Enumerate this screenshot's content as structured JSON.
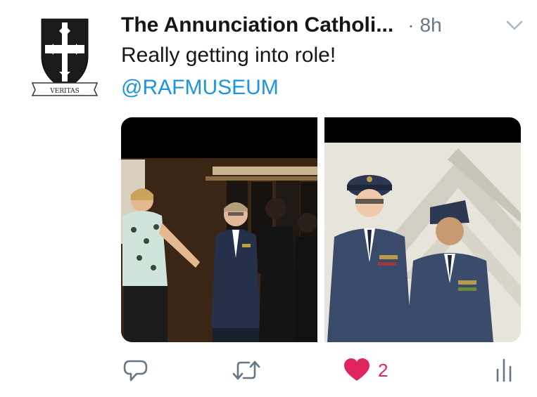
{
  "tweet": {
    "author_name": "The Annunciation Catholi...",
    "separator": "·",
    "time": "8h",
    "text": "Really getting into role!",
    "mention": "@RAFMUSEUM",
    "avatar_icon": "school-crest-icon",
    "avatar_motto": "VERITAS"
  },
  "media": {
    "photos": [
      {
        "name": "photo-left"
      },
      {
        "name": "photo-right"
      }
    ]
  },
  "actions": {
    "reply_icon": "reply-icon",
    "retweet_icon": "retweet-icon",
    "like_icon": "heart-icon",
    "like_count": "2",
    "analytics_icon": "analytics-icon"
  },
  "colors": {
    "text": "#14171a",
    "secondary": "#657786",
    "link": "#1b95e0",
    "like": "#e0245e"
  }
}
